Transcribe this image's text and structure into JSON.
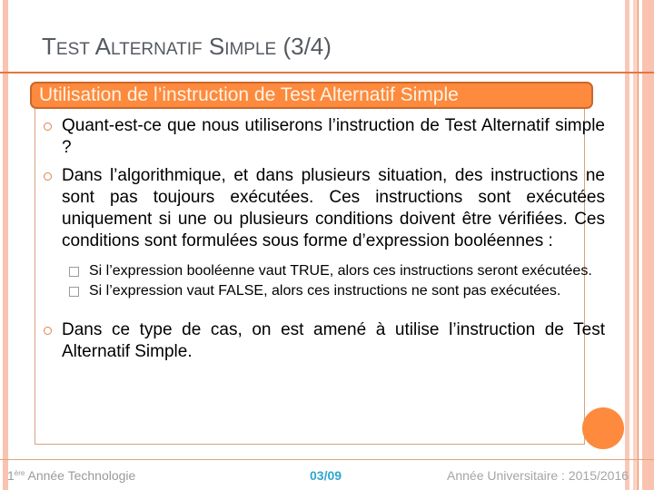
{
  "slide": {
    "title": {
      "word1_initial": "T",
      "word1_rest": "EST",
      "word2_initial": "A",
      "word2_rest": "LTERNATIF",
      "word3_initial": "S",
      "word3_rest": "IMPLE",
      "suffix": "(3/4)"
    },
    "section_header": "Utilisation de l’instruction de Test Alternatif Simple",
    "bullets": [
      {
        "text": "Quant-est-ce que nous utiliserons l’instruction de Test Alternatif simple ?"
      },
      {
        "text": "Dans l’algorithmique, et dans plusieurs situation, des instructions ne sont pas toujours exécutées. Ces instructions sont exécutées uniquement si une ou plusieurs conditions doivent être vérifiées. Ces conditions sont formulées sous forme d’expression booléennes :"
      },
      {
        "text": "Dans ce type de cas, on est amené à utilise l’instruction de Test Alternatif Simple."
      }
    ],
    "sub_bullets": [
      {
        "text": "Si l’expression booléenne vaut TRUE, alors ces instructions seront exécutées."
      },
      {
        "text": "Si l’expression vaut FALSE, alors ces instructions ne sont pas exécutées."
      }
    ]
  },
  "footer": {
    "left_prefix": "1",
    "left_sup": "ère",
    "left_text": " Année Technologie",
    "page_number": "03/09",
    "right_text": "Année Universitaire : 2015/2016"
  },
  "colors": {
    "accent_orange": "#fd8a3d",
    "page_number_blue": "#2fa6d0",
    "title_gray": "#555a60"
  }
}
